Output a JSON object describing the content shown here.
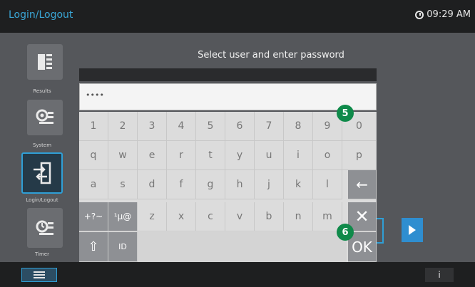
{
  "header": {
    "title": "Login/Logout",
    "time": "09:29 AM"
  },
  "sidebar": {
    "items": [
      {
        "label": "Results"
      },
      {
        "label": "System"
      },
      {
        "label": "Login/Logout"
      },
      {
        "label": "Timer"
      }
    ]
  },
  "login": {
    "prompt": "Select user and enter password",
    "password_mask": "••••"
  },
  "keyboard": {
    "row1": [
      "1",
      "2",
      "3",
      "4",
      "5",
      "6",
      "7",
      "8",
      "9",
      "0"
    ],
    "row2": [
      "q",
      "w",
      "e",
      "r",
      "t",
      "y",
      "u",
      "i",
      "o",
      "p"
    ],
    "row3": [
      "a",
      "s",
      "d",
      "f",
      "g",
      "h",
      "j",
      "k",
      "l"
    ],
    "row4": [
      "z",
      "x",
      "c",
      "v",
      "b",
      "n",
      "m"
    ],
    "symbols_key": "+?~",
    "special_key": "¹µ@",
    "shift_key": "⇧",
    "id_key": "ID",
    "backspace_key": "←",
    "cancel_key": "✕",
    "ok_key": "OK"
  },
  "callouts": {
    "first": "5",
    "second": "6"
  },
  "footer": {
    "info_label": "i"
  }
}
